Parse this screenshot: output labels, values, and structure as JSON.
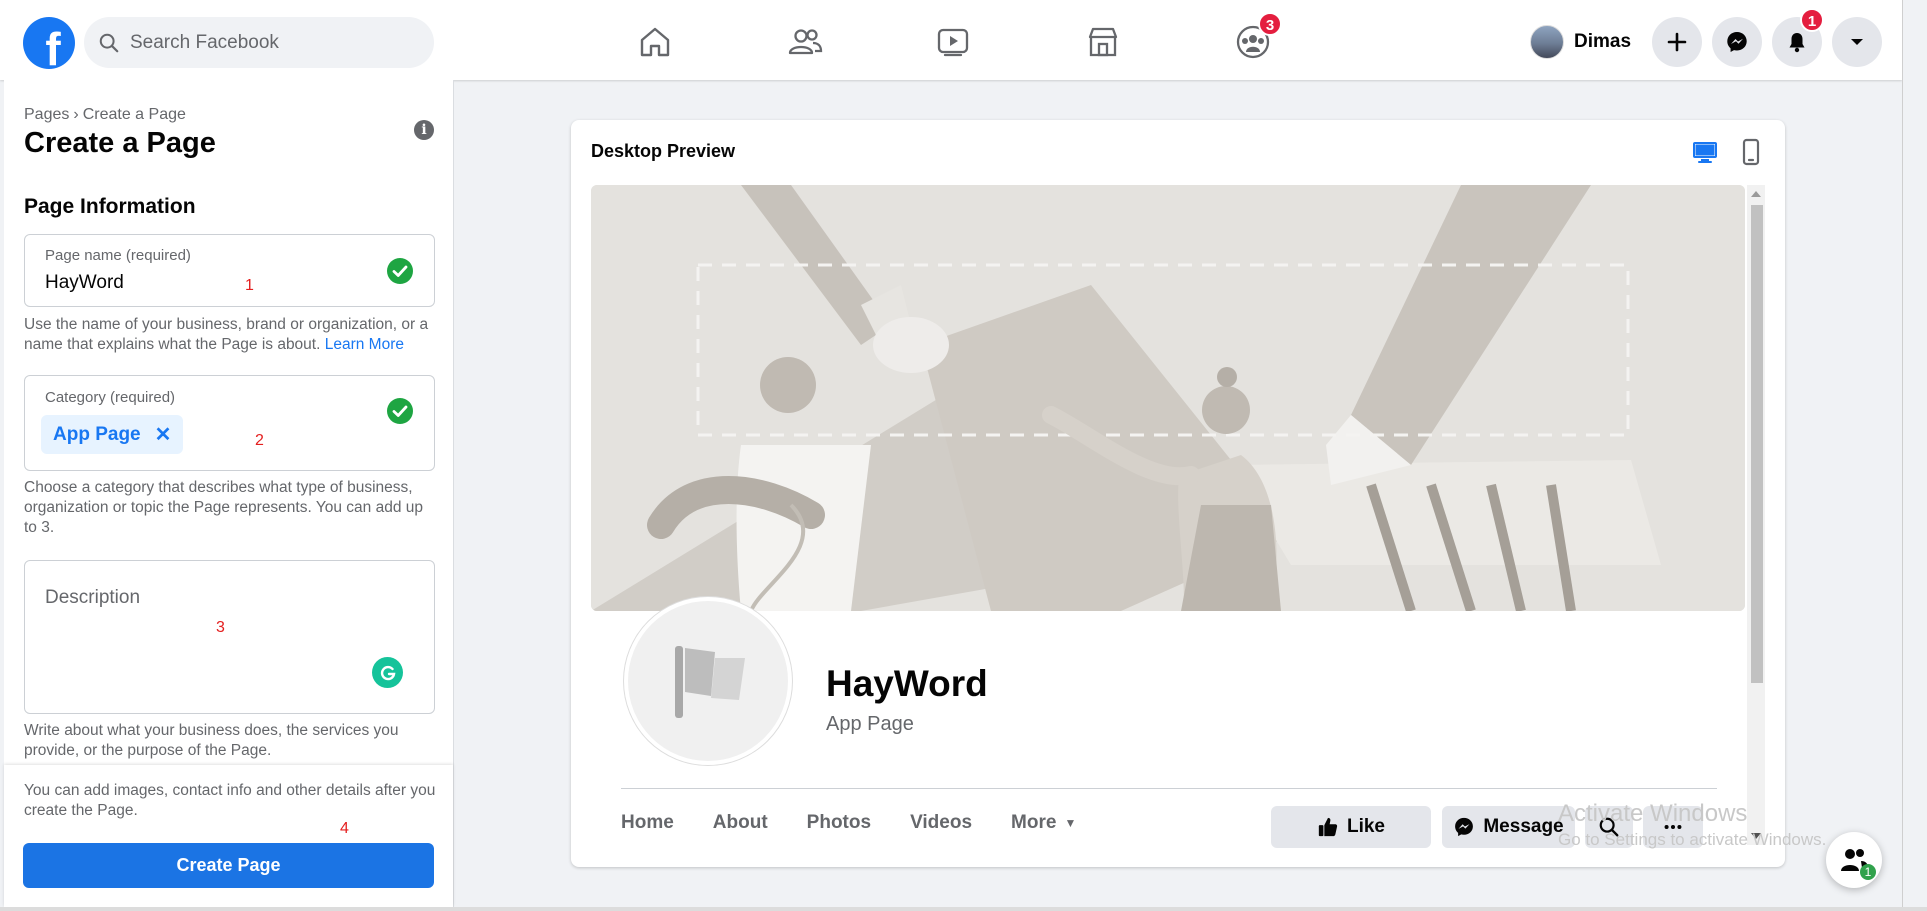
{
  "topbar": {
    "logo": "facebook-logo",
    "search_placeholder": "Search Facebook",
    "nav": [
      "home-icon",
      "friends-icon",
      "watch-icon",
      "marketplace-icon",
      "groups-icon"
    ],
    "groups_badge": "3",
    "profile_name": "Dimas",
    "notifications_badge": "1"
  },
  "left": {
    "breadcrumb_root": "Pages",
    "breadcrumb_sep": "›",
    "breadcrumb_current": "Create a Page",
    "title": "Create a Page",
    "section_title": "Page Information",
    "page_name_label": "Page name (required)",
    "page_name_value": "HayWord",
    "page_name_help": "Use the name of your business, brand or organization, or a name that explains what the Page is about.",
    "learn_more": "Learn More",
    "category_label": "Category (required)",
    "category_chip": "App Page",
    "category_chip_remove": "✕",
    "category_help": "Choose a category that describes what type of business, organization or topic the Page represents. You can add up to 3.",
    "description_placeholder": "Description",
    "description_help": "Write about what your business does, the services you provide, or the purpose of the Page.",
    "footer_note": "You can add images, contact info and other details after you create the Page.",
    "create_button": "Create Page",
    "annotations": [
      "1",
      "2",
      "3",
      "4"
    ]
  },
  "preview": {
    "title": "Desktop Preview",
    "page_name": "HayWord",
    "page_category": "App Page",
    "tabs": [
      "Home",
      "About",
      "Photos",
      "Videos",
      "More"
    ],
    "like_button": "Like",
    "message_button": "Message"
  },
  "watermark": {
    "line1": "Activate Windows",
    "line2": "Go to Settings to activate Windows."
  },
  "chat_count": "1",
  "colors": {
    "brand_blue": "#1877f2",
    "badge_red": "#e41e3f",
    "check_green": "#1ea542"
  }
}
